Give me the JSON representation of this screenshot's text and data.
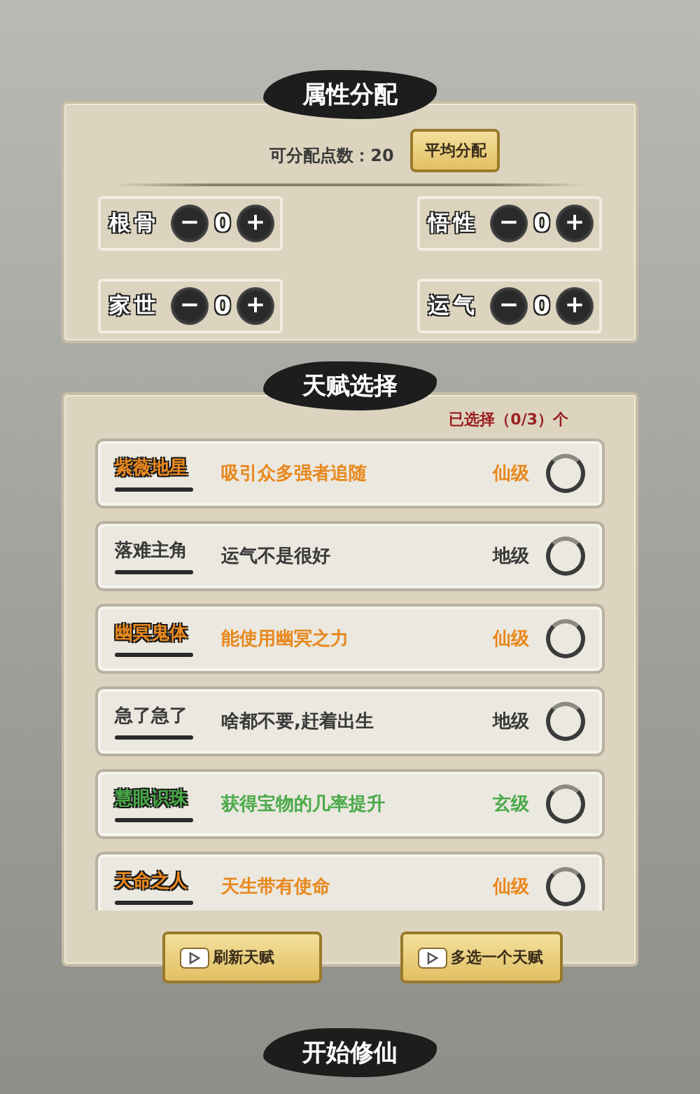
{
  "attributes": {
    "title": "属性分配",
    "points_label": "可分配点数：20",
    "auto_button": "平均分配",
    "stats": [
      {
        "label": "根骨",
        "minus": "−",
        "value": "0",
        "plus": "+"
      },
      {
        "label": "悟性",
        "minus": "−",
        "value": "0",
        "plus": "+"
      },
      {
        "label": "家世",
        "minus": "−",
        "value": "0",
        "plus": "+"
      },
      {
        "label": "运气",
        "minus": "−",
        "value": "0",
        "plus": "+"
      }
    ]
  },
  "talents": {
    "title": "天赋选择",
    "counter": "已选择（0/3）个",
    "items": [
      {
        "name": "紫薇地星",
        "description": "吸引众多强者追随",
        "grade": "仙级",
        "color": "#e8881e",
        "selected": false
      },
      {
        "name": "落难主角",
        "description": "运气不是很好",
        "grade": "地级",
        "color": "#3a3a3a",
        "selected": false
      },
      {
        "name": "幽冥鬼体",
        "description": "能使用幽冥之力",
        "grade": "仙级",
        "color": "#e8881e",
        "selected": false
      },
      {
        "name": "急了急了",
        "description": "啥都不要,赶着出生",
        "grade": "地级",
        "color": "#3a3a3a",
        "selected": false
      },
      {
        "name": "慧眼识珠",
        "description": "获得宝物的几率提升",
        "grade": "玄级",
        "color": "#4aaa4a",
        "selected": false
      },
      {
        "name": "天命之人",
        "description": "天生带有使命",
        "grade": "仙级",
        "color": "#e8881e",
        "selected": false
      }
    ],
    "buttons": [
      "刷新天赋",
      "多选一个天赋"
    ]
  },
  "start_button": "开始修仙"
}
